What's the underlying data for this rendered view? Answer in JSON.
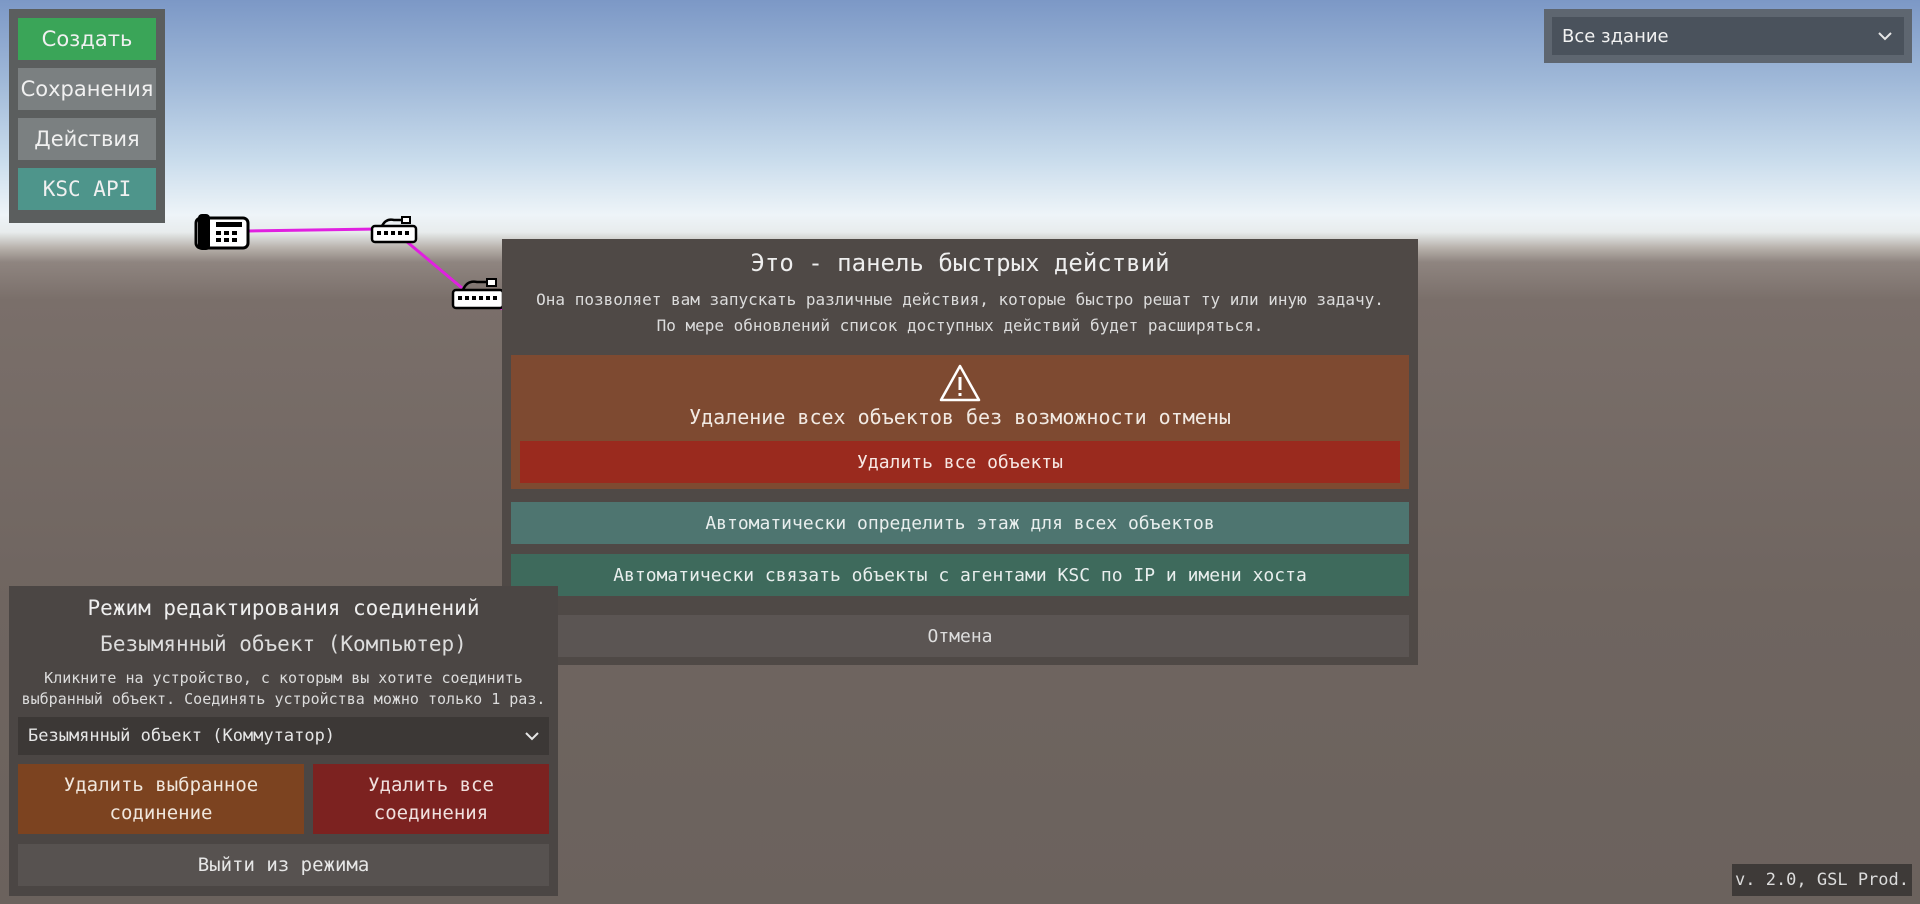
{
  "top_menu": {
    "create": "Создать",
    "saves": "Сохранения",
    "actions": "Действия",
    "ksc_api": "KSC API"
  },
  "scope": {
    "selected": "Все здание"
  },
  "quick_actions": {
    "title": "Это - панель быстрых действий",
    "description_line1": "Она позволяет вам запускать различные действия, которые быстро решат ту или иную задачу.",
    "description_line2": "По мере обновлений список доступных действий будет расширяться.",
    "warning_text": "Удаление всех объектов без возможности отмены",
    "delete_all_objects": "Удалить все объекты",
    "auto_floor": "Автоматически определить этаж для всех объектов",
    "auto_link_ksc": "Автоматически связать объекты с агентами KSC по IP и имени хоста",
    "cancel": "Отмена"
  },
  "connection_panel": {
    "title": "Режим редактирования соединений",
    "object_name": "Безымянный объект (Компьютер)",
    "hint_line1": "Кликните на устройство, с которым вы хотите соединить",
    "hint_line2": "выбранный объект. Соединять устройства можно только 1 раз.",
    "selected_connection": "Безымянный объект (Коммутатор)",
    "delete_selected_line1": "Удалить выбранное",
    "delete_selected_line2": "содинение",
    "delete_all_line1": "Удалить все",
    "delete_all_line2": "соединения",
    "exit_mode": "Выйти из режима"
  },
  "version": "v. 2.0, GSL Prod.",
  "colors": {
    "connection_line": "#e020e0",
    "create_button": "#3aa558",
    "danger": "#9a2a1e"
  },
  "scene_icons": [
    "phone-icon",
    "switch-icon",
    "switch-icon"
  ]
}
